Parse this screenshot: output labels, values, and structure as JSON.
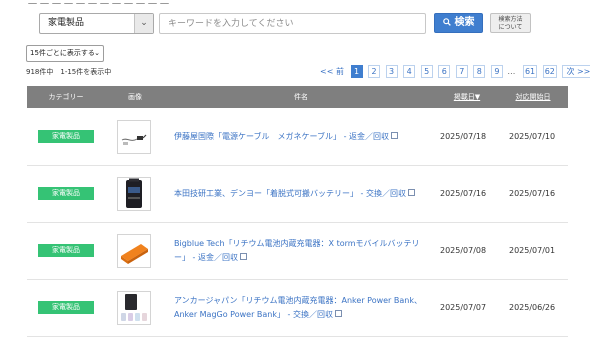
{
  "search": {
    "category_value": "家電製品",
    "keyword_placeholder": "キーワードを入力してください",
    "search_button_label": "検索",
    "method_button_line1": "検索方法",
    "method_button_line2": "について"
  },
  "listing": {
    "per_page_value": "15件ごとに表示する",
    "count_text": "918件中　1-15件を表示中"
  },
  "pagination": {
    "prev_label": "<< 前",
    "pages": [
      "1",
      "2",
      "3",
      "4",
      "5",
      "6",
      "7",
      "8",
      "9"
    ],
    "current_page": "1",
    "ellipsis": "…",
    "tail_pages": [
      "61",
      "62"
    ],
    "next_label": "次 >>"
  },
  "table": {
    "headers": {
      "category": "カテゴリー",
      "image": "画像",
      "name": "件名",
      "posted": "掲載日▼",
      "start": "対応開始日"
    },
    "rows": [
      {
        "category": "家電製品",
        "image_icon": "cable-product-image",
        "title": "伊藤屋国際「電源ケーブル　メガネケーブル」 - 返金／回収",
        "posted": "2025/07/18",
        "start": "2025/07/10"
      },
      {
        "category": "家電製品",
        "image_icon": "battery-product-image",
        "title": "本田技研工業、デンヨー「着脱式可搬バッテリー」 - 交換／回収",
        "posted": "2025/07/16",
        "start": "2025/07/16"
      },
      {
        "category": "家電製品",
        "image_icon": "power-bank-orange-image",
        "title": "Bigblue Tech「リチウム電池内蔵充電器：X tormモバイルバッテリー」 - 返金／回収",
        "posted": "2025/07/08",
        "start": "2025/07/01"
      },
      {
        "category": "家電製品",
        "image_icon": "power-bank-set-image",
        "title": "アンカージャパン「リチウム電池内蔵充電器：Anker Power Bank、Anker MagGo Power Bank」 - 交換／回収",
        "posted": "2025/07/07",
        "start": "2025/06/26"
      }
    ]
  },
  "colors": {
    "accent_blue": "#3f7ecf",
    "badge_green": "#35c375",
    "header_gray": "#7f7f7f",
    "link_blue": "#3b73c4"
  }
}
